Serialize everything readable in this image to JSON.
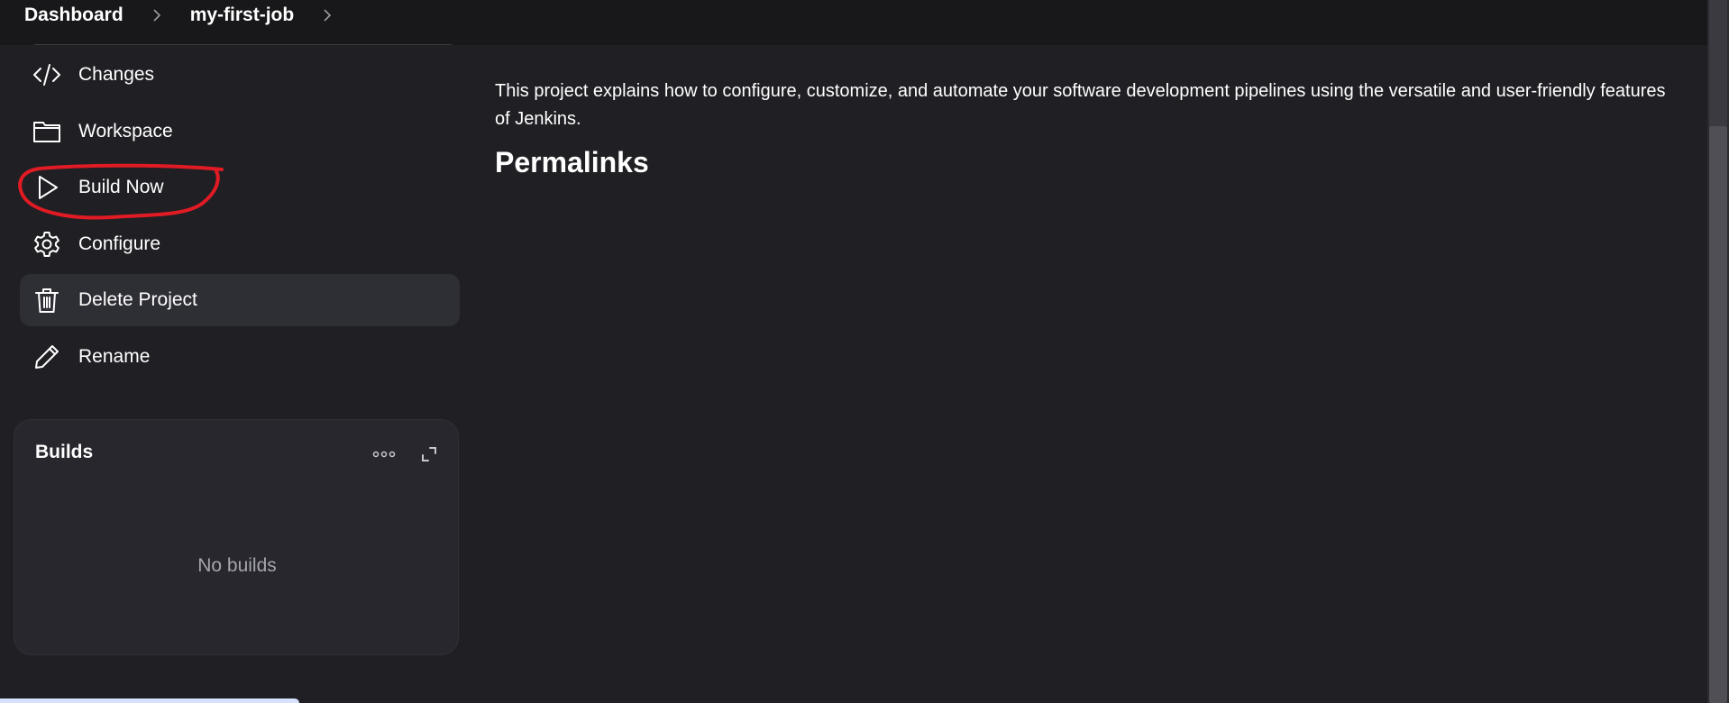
{
  "breadcrumb": {
    "items": [
      "Dashboard",
      "my-first-job"
    ]
  },
  "sidebar": {
    "tasks": [
      {
        "label": "Changes",
        "icon": "code-icon"
      },
      {
        "label": "Workspace",
        "icon": "folder-icon"
      },
      {
        "label": "Build Now",
        "icon": "play-icon"
      },
      {
        "label": "Configure",
        "icon": "gear-icon"
      },
      {
        "label": "Delete Project",
        "icon": "trash-icon"
      },
      {
        "label": "Rename",
        "icon": "pencil-icon"
      }
    ]
  },
  "builds": {
    "title": "Builds",
    "empty_text": "No builds"
  },
  "main": {
    "description": "This project explains  how to configure, customize, and automate your software development pipelines using the versatile and user-friendly features of Jenkins.",
    "heading": "Permalinks"
  },
  "colors": {
    "background": "#1f1f24",
    "header": "#18181b",
    "active_item": "#2e2e35",
    "annotation": "#e01b24"
  }
}
